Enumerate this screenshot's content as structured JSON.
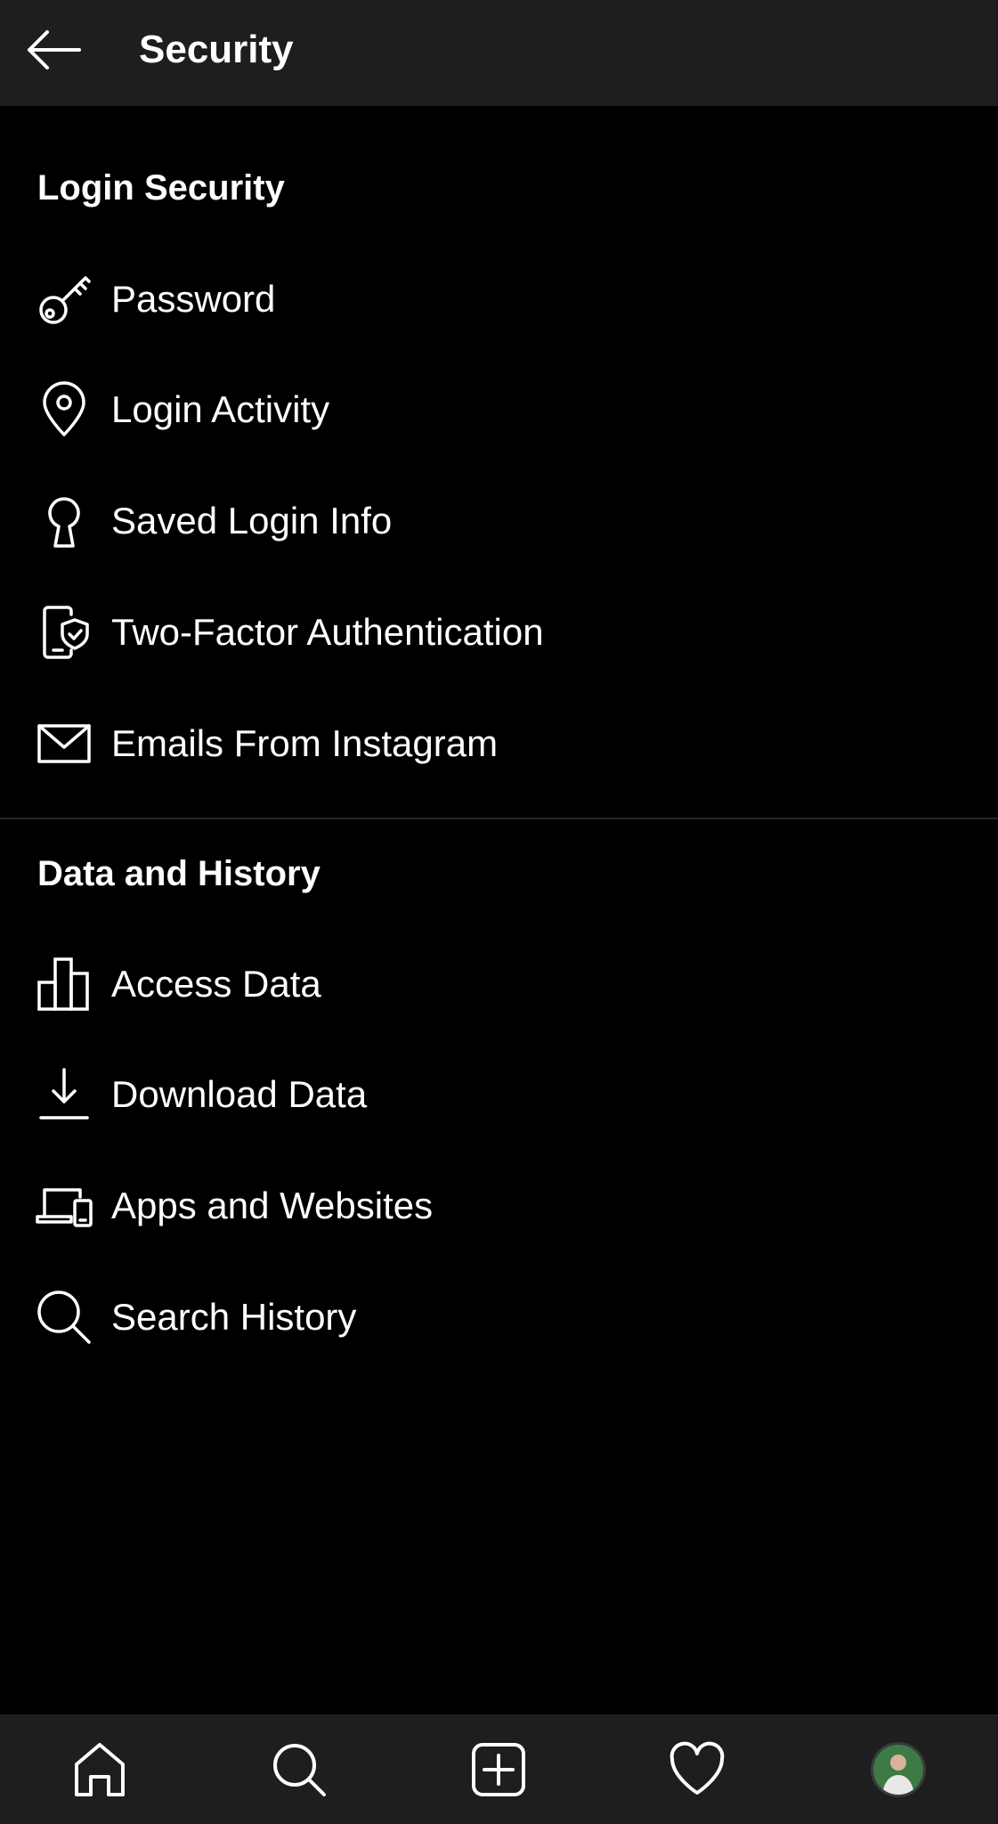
{
  "header": {
    "title": "Security",
    "back_icon": "arrow-left-icon"
  },
  "sections": [
    {
      "title": "Login Security",
      "items": [
        {
          "label": "Password",
          "icon": "key-icon"
        },
        {
          "label": "Login Activity",
          "icon": "location-pin-icon"
        },
        {
          "label": "Saved Login Info",
          "icon": "keyhole-icon"
        },
        {
          "label": "Two-Factor Authentication",
          "icon": "phone-shield-icon"
        },
        {
          "label": "Emails From Instagram",
          "icon": "envelope-icon"
        }
      ]
    },
    {
      "title": "Data and History",
      "items": [
        {
          "label": "Access Data",
          "icon": "bar-chart-icon"
        },
        {
          "label": "Download Data",
          "icon": "download-icon"
        },
        {
          "label": "Apps and Websites",
          "icon": "devices-icon"
        },
        {
          "label": "Search History",
          "icon": "search-icon"
        }
      ]
    }
  ],
  "bottom_nav": [
    {
      "icon": "home-icon"
    },
    {
      "icon": "search-icon"
    },
    {
      "icon": "new-post-icon"
    },
    {
      "icon": "heart-icon"
    },
    {
      "icon": "profile-avatar"
    }
  ],
  "colors": {
    "background": "#000000",
    "bar_background": "#1e1e1e",
    "text": "#ffffff",
    "divider": "#262626"
  }
}
